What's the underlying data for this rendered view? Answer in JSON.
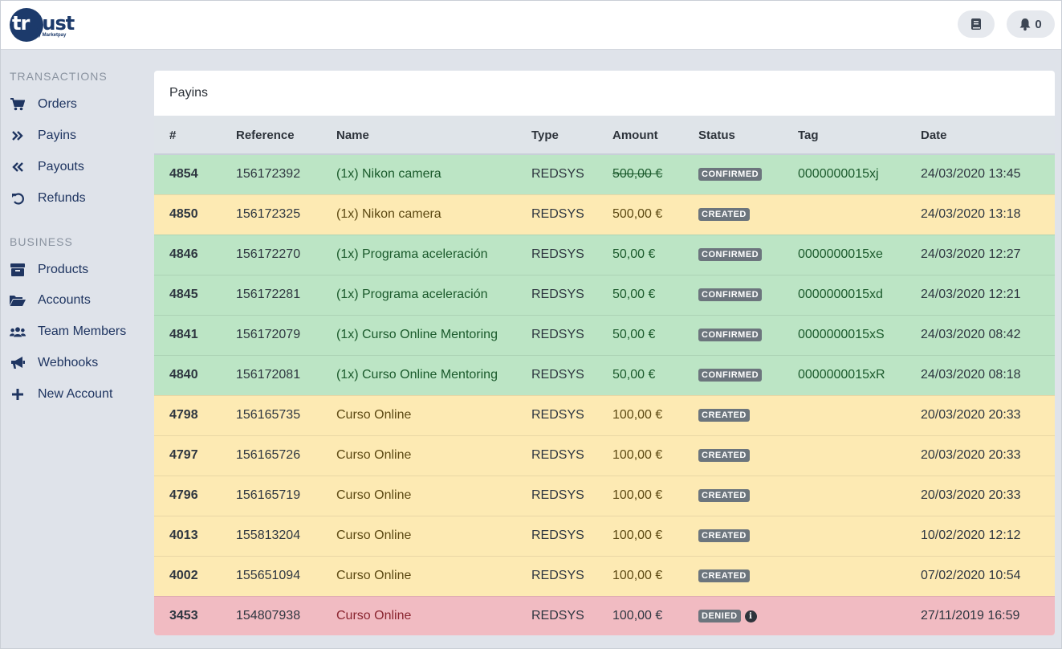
{
  "brand": {
    "logo_first": "tr",
    "logo_rest": "uust",
    "logo_sub": "by Marketpay"
  },
  "header": {
    "notification_count": "0"
  },
  "sidebar": {
    "sections": [
      {
        "title": "TRANSACTIONS",
        "items": [
          {
            "label": "Orders",
            "icon": "cart-icon"
          },
          {
            "label": "Payins",
            "icon": "double-chevron-right-icon"
          },
          {
            "label": "Payouts",
            "icon": "double-chevron-left-icon"
          },
          {
            "label": "Refunds",
            "icon": "undo-icon"
          }
        ]
      },
      {
        "title": "BUSINESS",
        "items": [
          {
            "label": "Products",
            "icon": "box-icon"
          },
          {
            "label": "Accounts",
            "icon": "folder-open-icon"
          },
          {
            "label": "Team Members",
            "icon": "users-icon"
          },
          {
            "label": "Webhooks",
            "icon": "bullhorn-icon"
          },
          {
            "label": "New Account",
            "icon": "plus-icon"
          }
        ]
      }
    ]
  },
  "main": {
    "title": "Payins",
    "columns": [
      "#",
      "Reference",
      "Name",
      "Type",
      "Amount",
      "Status",
      "Tag",
      "Date"
    ],
    "rows": [
      {
        "id": "4854",
        "reference": "156172392",
        "name": "(1x) Nikon camera",
        "type": "REDSYS",
        "amount": "500,00 €",
        "amount_struck": true,
        "status": "CONFIRMED",
        "tag": "0000000015xj",
        "date": "24/03/2020 13:45",
        "color": "green"
      },
      {
        "id": "4850",
        "reference": "156172325",
        "name": "(1x) Nikon camera",
        "type": "REDSYS",
        "amount": "500,00 €",
        "amount_struck": false,
        "status": "CREATED",
        "tag": "",
        "date": "24/03/2020 13:18",
        "color": "yellow"
      },
      {
        "id": "4846",
        "reference": "156172270",
        "name": "(1x) Programa aceleración",
        "type": "REDSYS",
        "amount": "50,00 €",
        "amount_struck": false,
        "status": "CONFIRMED",
        "tag": "0000000015xe",
        "date": "24/03/2020 12:27",
        "color": "green"
      },
      {
        "id": "4845",
        "reference": "156172281",
        "name": "(1x) Programa aceleración",
        "type": "REDSYS",
        "amount": "50,00 €",
        "amount_struck": false,
        "status": "CONFIRMED",
        "tag": "0000000015xd",
        "date": "24/03/2020 12:21",
        "color": "green"
      },
      {
        "id": "4841",
        "reference": "156172079",
        "name": "(1x) Curso Online Mentoring",
        "type": "REDSYS",
        "amount": "50,00 €",
        "amount_struck": false,
        "status": "CONFIRMED",
        "tag": "0000000015xS",
        "date": "24/03/2020 08:42",
        "color": "green"
      },
      {
        "id": "4840",
        "reference": "156172081",
        "name": "(1x) Curso Online Mentoring",
        "type": "REDSYS",
        "amount": "50,00 €",
        "amount_struck": false,
        "status": "CONFIRMED",
        "tag": "0000000015xR",
        "date": "24/03/2020 08:18",
        "color": "green"
      },
      {
        "id": "4798",
        "reference": "156165735",
        "name": "Curso Online",
        "type": "REDSYS",
        "amount": "100,00 €",
        "amount_struck": false,
        "status": "CREATED",
        "tag": "",
        "date": "20/03/2020 20:33",
        "color": "yellow"
      },
      {
        "id": "4797",
        "reference": "156165726",
        "name": "Curso Online",
        "type": "REDSYS",
        "amount": "100,00 €",
        "amount_struck": false,
        "status": "CREATED",
        "tag": "",
        "date": "20/03/2020 20:33",
        "color": "yellow"
      },
      {
        "id": "4796",
        "reference": "156165719",
        "name": "Curso Online",
        "type": "REDSYS",
        "amount": "100,00 €",
        "amount_struck": false,
        "status": "CREATED",
        "tag": "",
        "date": "20/03/2020 20:33",
        "color": "yellow"
      },
      {
        "id": "4013",
        "reference": "155813204",
        "name": "Curso Online",
        "type": "REDSYS",
        "amount": "100,00 €",
        "amount_struck": false,
        "status": "CREATED",
        "tag": "",
        "date": "10/02/2020 12:12",
        "color": "yellow"
      },
      {
        "id": "4002",
        "reference": "155651094",
        "name": "Curso Online",
        "type": "REDSYS",
        "amount": "100,00 €",
        "amount_struck": false,
        "status": "CREATED",
        "tag": "",
        "date": "07/02/2020 10:54",
        "color": "yellow"
      },
      {
        "id": "3453",
        "reference": "154807938",
        "name": "Curso Online",
        "type": "REDSYS",
        "amount": "100,00 €",
        "amount_struck": false,
        "status": "DENIED",
        "tag": "",
        "date": "27/11/2019 16:59",
        "color": "red",
        "info": true
      }
    ]
  },
  "colors": {
    "confirmed_row": "#bce5c5",
    "created_row": "#fdeab3",
    "denied_row": "#f1bbc2",
    "brand": "#1c3a6b"
  }
}
